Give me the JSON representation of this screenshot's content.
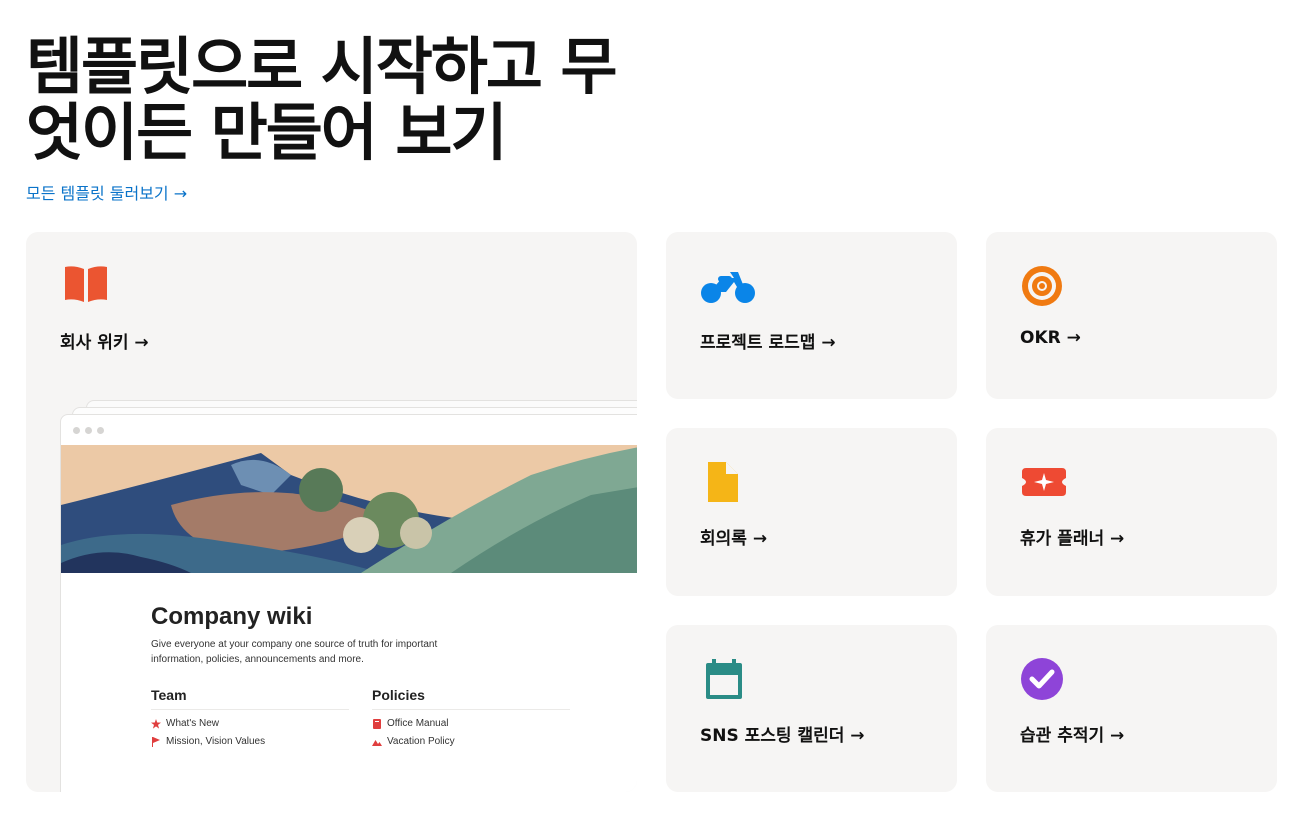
{
  "hero": {
    "title": "템플릿으로 시작하고 무엇이든 만들어 보기",
    "browse_link": "모든 템플릿 둘러보기 →"
  },
  "cards": [
    {
      "title": "회사 위키 →",
      "icon": "book-icon",
      "icon_color": "#eb5531"
    },
    {
      "title": "프로젝트 로드맵 →",
      "icon": "motorcycle-icon",
      "icon_color": "#0a85e8"
    },
    {
      "title": "OKR →",
      "icon": "target-icon",
      "icon_color": "#f07a11"
    },
    {
      "title": "회의록 →",
      "icon": "document-icon",
      "icon_color": "#f5b517"
    },
    {
      "title": "휴가 플래너 →",
      "icon": "airplane-ticket-icon",
      "icon_color": "#ee4a33"
    },
    {
      "title": "SNS 포스팅 캘린더 →",
      "icon": "calendar-icon",
      "icon_color": "#2a8c86"
    },
    {
      "title": "습관 추적기 →",
      "icon": "check-circle-icon",
      "icon_color": "#8e44d8"
    }
  ],
  "wiki_preview": {
    "title": "Company wiki",
    "description": "Give everyone at your company one source of truth for important information, policies, announcements and more.",
    "columns": [
      {
        "heading": "Team",
        "items": [
          {
            "label": "What's New",
            "icon": "star-icon",
            "color": "#e03e3e"
          },
          {
            "label": "Mission, Vision Values",
            "icon": "flag-icon",
            "color": "#e03e3e"
          }
        ]
      },
      {
        "heading": "Policies",
        "items": [
          {
            "label": "Office Manual",
            "icon": "book-icon",
            "color": "#e03e3e"
          },
          {
            "label": "Vacation Policy",
            "icon": "mountain-icon",
            "color": "#e03e3e"
          }
        ]
      }
    ]
  },
  "colors": {
    "link": "#0a73c9",
    "card_bg": "#f6f5f4"
  }
}
